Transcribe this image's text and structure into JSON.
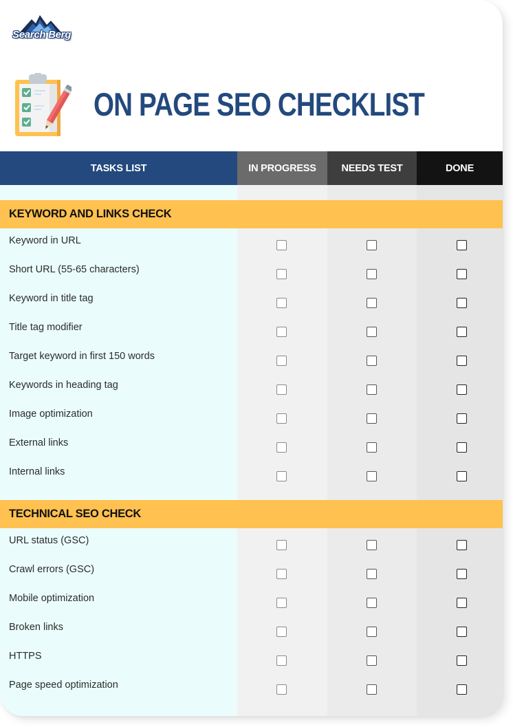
{
  "brand": {
    "logo_text": "Search Berg",
    "logo_icon": "mountain-logo-icon"
  },
  "header": {
    "title": "ON PAGE SEO CHECKLIST",
    "icon": "clipboard-checklist-icon"
  },
  "colors": {
    "title": "#23497e",
    "tasks_header": "#23497e",
    "in_progress_header": "#6b6b6b",
    "needs_test_header": "#3e3e3e",
    "done_header": "#131313",
    "section_band": "#ffc150",
    "tasks_column_bg": "#eafdfc"
  },
  "table": {
    "columns": [
      "TASKS LIST",
      "IN PROGRESS",
      "NEEDS TEST",
      "DONE"
    ],
    "sections": [
      {
        "title": "KEYWORD AND LINKS CHECK",
        "items": [
          {
            "label": "Keyword in URL",
            "in_progress": false,
            "needs_test": false,
            "done": false
          },
          {
            "label": "Short URL (55-65 characters)",
            "in_progress": false,
            "needs_test": false,
            "done": false
          },
          {
            "label": "Keyword in title tag",
            "in_progress": false,
            "needs_test": false,
            "done": false
          },
          {
            "label": "Title tag modifier",
            "in_progress": false,
            "needs_test": false,
            "done": false
          },
          {
            "label": "Target keyword in first 150 words",
            "in_progress": false,
            "needs_test": false,
            "done": false
          },
          {
            "label": "Keywords in heading tag",
            "in_progress": false,
            "needs_test": false,
            "done": false
          },
          {
            "label": "Image optimization",
            "in_progress": false,
            "needs_test": false,
            "done": false
          },
          {
            "label": "External links",
            "in_progress": false,
            "needs_test": false,
            "done": false
          },
          {
            "label": "Internal links",
            "in_progress": false,
            "needs_test": false,
            "done": false
          }
        ]
      },
      {
        "title": "TECHNICAL SEO CHECK",
        "items": [
          {
            "label": "URL status (GSC)",
            "in_progress": false,
            "needs_test": false,
            "done": false
          },
          {
            "label": "Crawl errors  (GSC)",
            "in_progress": false,
            "needs_test": false,
            "done": false
          },
          {
            "label": "Mobile optimization",
            "in_progress": false,
            "needs_test": false,
            "done": false
          },
          {
            "label": "Broken links",
            "in_progress": false,
            "needs_test": false,
            "done": false
          },
          {
            "label": "HTTPS",
            "in_progress": false,
            "needs_test": false,
            "done": false
          },
          {
            "label": "Page speed optimization",
            "in_progress": false,
            "needs_test": false,
            "done": false
          }
        ]
      }
    ]
  }
}
